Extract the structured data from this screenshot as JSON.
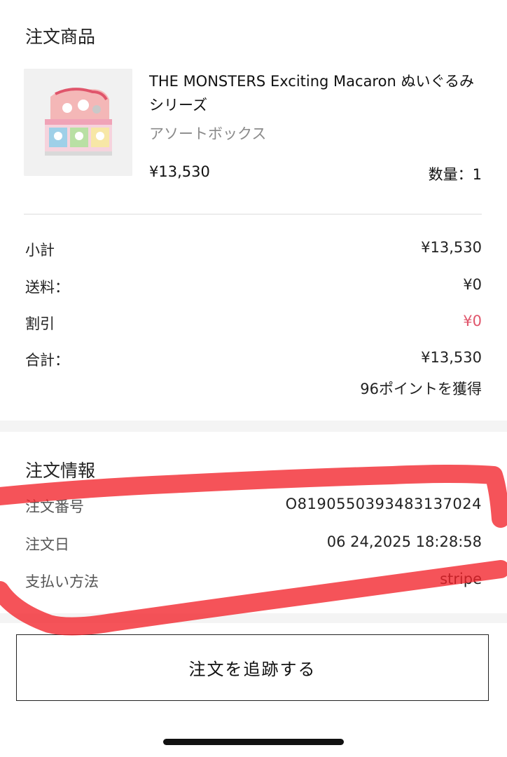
{
  "order_items": {
    "section_title": "注文商品",
    "product": {
      "name": "THE MONSTERS Exciting Macaron ぬいぐるみシリーズ",
      "variant": "アソートボックス",
      "price": "¥13,530",
      "quantity_label": "数量：1",
      "image_icon": "product-box-image"
    }
  },
  "summary": {
    "subtotal_label": "小計",
    "subtotal_value": "¥13,530",
    "shipping_label": "送料：",
    "shipping_value": "¥0",
    "discount_label": "割引",
    "discount_value": "¥0",
    "total_label": "合計：",
    "total_value": "¥13,530",
    "points_text": "96ポイントを獲得"
  },
  "order_info": {
    "section_title": "注文情報",
    "order_number_label": "注文番号",
    "order_number_value": "O8190550393483137024",
    "order_date_label": "注文日",
    "order_date_value": "06 24,2025 18:28:58",
    "payment_label": "支払い方法",
    "payment_value": "stripe"
  },
  "actions": {
    "track_order_label": "注文を追跡する"
  },
  "colors": {
    "discount": "#e0556b",
    "scribble": "#f2232a",
    "band": "#f4f4f4"
  }
}
